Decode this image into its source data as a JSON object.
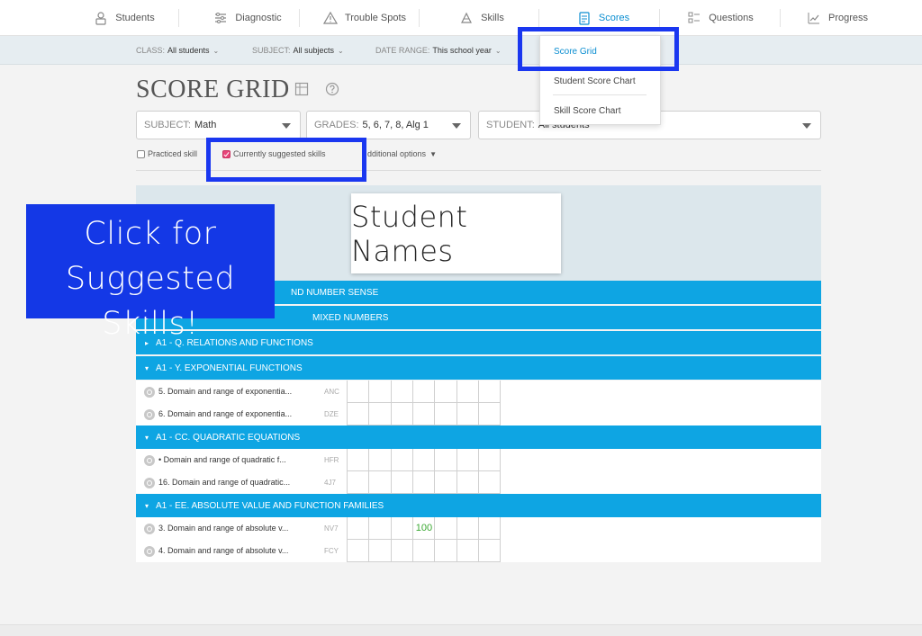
{
  "nav": {
    "items": [
      {
        "label": "Students",
        "icon": "students-icon",
        "active": false
      },
      {
        "label": "Diagnostic",
        "icon": "diagnostic-icon",
        "active": false
      },
      {
        "label": "Trouble Spots",
        "icon": "warning-icon",
        "active": false
      },
      {
        "label": "Skills",
        "icon": "skills-icon",
        "active": false
      },
      {
        "label": "Scores",
        "icon": "scores-icon",
        "active": true
      },
      {
        "label": "Questions",
        "icon": "questions-icon",
        "active": false
      },
      {
        "label": "Progress",
        "icon": "progress-icon",
        "active": false
      }
    ]
  },
  "filters": {
    "class_label": "CLASS:",
    "class_value": "All students",
    "subject_label": "SUBJECT:",
    "subject_value": "All subjects",
    "date_label": "DATE RANGE:",
    "date_value": "This school year"
  },
  "page": {
    "title": "SCORE GRID",
    "subject_label": "SUBJECT:",
    "subject_value": "Math",
    "grades_label": "GRADES:",
    "grades_value": "5, 6, 7, 8, Alg 1",
    "student_label": "STUDENT:",
    "student_value": "All students",
    "practiced_label": "Practiced skill",
    "suggested_label": "Currently suggested skills",
    "options_label": "dditional options"
  },
  "menu": {
    "items": [
      "Score Grid",
      "Student Score Chart",
      "Skill Score Chart"
    ]
  },
  "grid": {
    "names_card": "Student Names",
    "categories": [
      {
        "arrow": "▸",
        "label": "ND NUMBER SENSE"
      },
      {
        "arrow": "▸",
        "label": "MIXED NUMBERS"
      },
      {
        "arrow": "▸",
        "label": "A1 - Q. RELATIONS AND FUNCTIONS"
      },
      {
        "arrow": "▾",
        "label": "A1 - Y. EXPONENTIAL FUNCTIONS"
      },
      {
        "arrow": "▾",
        "label": "A1 - CC. QUADRATIC EQUATIONS"
      },
      {
        "arrow": "▾",
        "label": "A1 - EE. ABSOLUTE VALUE AND FUNCTION FAMILIES"
      }
    ],
    "skills": [
      {
        "name": "5. Domain and range of exponentia...",
        "code": "ANC",
        "scores": [
          "",
          "",
          "",
          "",
          "",
          "",
          ""
        ]
      },
      {
        "name": "6. Domain and range of exponentia...",
        "code": "DZE",
        "scores": [
          "",
          "",
          "",
          "",
          "",
          "",
          ""
        ]
      },
      {
        "name": "• Domain and range of quadratic f...",
        "code": "HFR",
        "scores": [
          "",
          "",
          "",
          "",
          "",
          "",
          ""
        ]
      },
      {
        "name": "16. Domain and range of quadratic...",
        "code": "4J7",
        "scores": [
          "",
          "",
          "",
          "",
          "",
          "",
          ""
        ]
      },
      {
        "name": "3. Domain and range of absolute v...",
        "code": "NV7",
        "scores": [
          "",
          "",
          "",
          "100",
          "",
          "",
          ""
        ]
      },
      {
        "name": "4. Domain and range of absolute v...",
        "code": "FCY",
        "scores": [
          "",
          "",
          "",
          "",
          "",
          "",
          ""
        ]
      }
    ]
  },
  "callout": {
    "line1": "Click for",
    "line2": "Suggested Skills!"
  },
  "colors": {
    "accent": "#0b8ed1",
    "category_bar": "#0ea5e3",
    "highlight": "#1a37f0",
    "callout": "#1438e6",
    "score": "#3aa832"
  }
}
